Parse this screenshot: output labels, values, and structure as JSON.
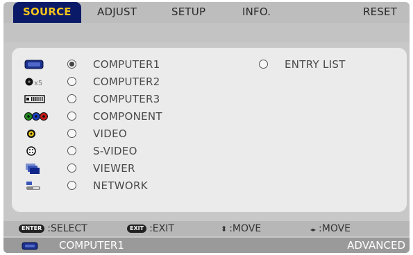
{
  "tabs": [
    {
      "label": "SOURCE",
      "active": true
    },
    {
      "label": "ADJUST",
      "active": false
    },
    {
      "label": "SETUP",
      "active": false
    },
    {
      "label": "INFO.",
      "active": false
    },
    {
      "label": "RESET",
      "active": false
    }
  ],
  "sources": [
    {
      "label": "COMPUTER1",
      "icon": "vga-connector-icon",
      "selected": true
    },
    {
      "label": "COMPUTER2",
      "icon": "multi-pin-connector-icon",
      "icon_text": "x5",
      "selected": false
    },
    {
      "label": "COMPUTER3",
      "icon": "dvi-connector-icon",
      "selected": false
    },
    {
      "label": "COMPONENT",
      "icon": "rgb-rca-connectors-icon",
      "selected": false
    },
    {
      "label": "VIDEO",
      "icon": "yellow-rca-connector-icon",
      "selected": false
    },
    {
      "label": "S-VIDEO",
      "icon": "svideo-connector-icon",
      "selected": false
    },
    {
      "label": "VIEWER",
      "icon": "viewer-icon",
      "selected": false
    },
    {
      "label": "NETWORK",
      "icon": "network-icon",
      "selected": false
    }
  ],
  "entry_list": {
    "label": "ENTRY LIST",
    "selected": false
  },
  "footer": {
    "enter_key": "ENTER",
    "enter_label": ":SELECT",
    "exit_key": "EXIT",
    "exit_label": ":EXIT",
    "updown_glyph": "⬍",
    "updown_label": ":MOVE",
    "leftright_glyph": "◂▸",
    "leftright_label": ":MOVE"
  },
  "status": {
    "source": "COMPUTER1",
    "mode": "ADVANCED"
  },
  "colors": {
    "tab_active_bg": "#0a1a68",
    "tab_active_text": "#f2c31a",
    "panel_bg": "#ebebeb"
  }
}
